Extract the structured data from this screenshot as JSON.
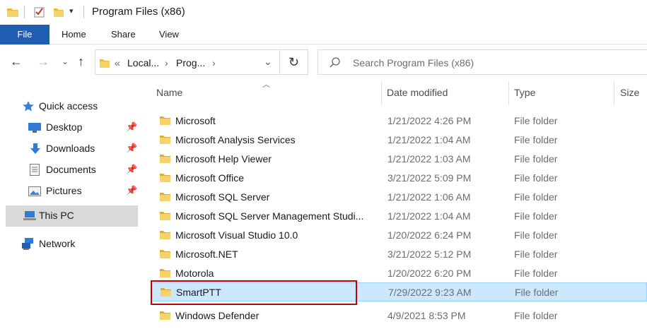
{
  "window": {
    "title": "Program Files (x86)"
  },
  "ribbon": {
    "tabs": [
      "File",
      "Home",
      "Share",
      "View"
    ]
  },
  "address": {
    "crumbs": [
      "Local...",
      "Prog..."
    ],
    "overflow": "«",
    "separator": "›"
  },
  "search": {
    "placeholder": "Search Program Files (x86)"
  },
  "nav": {
    "items": [
      {
        "label": "Quick access",
        "icon": "star-icon"
      },
      {
        "label": "Desktop",
        "icon": "desktop-icon",
        "pinned": true
      },
      {
        "label": "Downloads",
        "icon": "download-icon",
        "pinned": true
      },
      {
        "label": "Documents",
        "icon": "document-icon",
        "pinned": true
      },
      {
        "label": "Pictures",
        "icon": "picture-icon",
        "pinned": true
      },
      {
        "label": "This PC",
        "icon": "computer-icon",
        "selected": true
      },
      {
        "label": "Network",
        "icon": "network-icon"
      }
    ]
  },
  "columns": [
    "Name",
    "Date modified",
    "Type",
    "Size"
  ],
  "files": [
    {
      "name": "Microsoft",
      "date": "1/21/2022 4:26 PM",
      "type": "File folder"
    },
    {
      "name": "Microsoft Analysis Services",
      "date": "1/21/2022 1:04 AM",
      "type": "File folder"
    },
    {
      "name": "Microsoft Help Viewer",
      "date": "1/21/2022 1:03 AM",
      "type": "File folder"
    },
    {
      "name": "Microsoft Office",
      "date": "3/21/2022 5:09 PM",
      "type": "File folder"
    },
    {
      "name": "Microsoft SQL Server",
      "date": "1/21/2022 1:06 AM",
      "type": "File folder"
    },
    {
      "name": "Microsoft SQL Server Management Studi...",
      "date": "1/21/2022 1:04 AM",
      "type": "File folder"
    },
    {
      "name": "Microsoft Visual Studio 10.0",
      "date": "1/20/2022 6:24 PM",
      "type": "File folder"
    },
    {
      "name": "Microsoft.NET",
      "date": "3/21/2022 5:12 PM",
      "type": "File folder"
    },
    {
      "name": "Motorola",
      "date": "1/20/2022 6:20 PM",
      "type": "File folder"
    },
    {
      "name": "SmartPTT",
      "date": "7/29/2022 9:23 AM",
      "type": "File folder",
      "selected": true
    },
    {
      "name": "Windows Defender",
      "date": "4/9/2021 8:53 PM",
      "type": "File folder"
    }
  ],
  "colors": {
    "file_tab": "#1f5fb3",
    "selection_fill": "#cce8ff",
    "selection_border": "#99d1ff",
    "annotation": "#c00000",
    "folder": "#f2c94c"
  }
}
